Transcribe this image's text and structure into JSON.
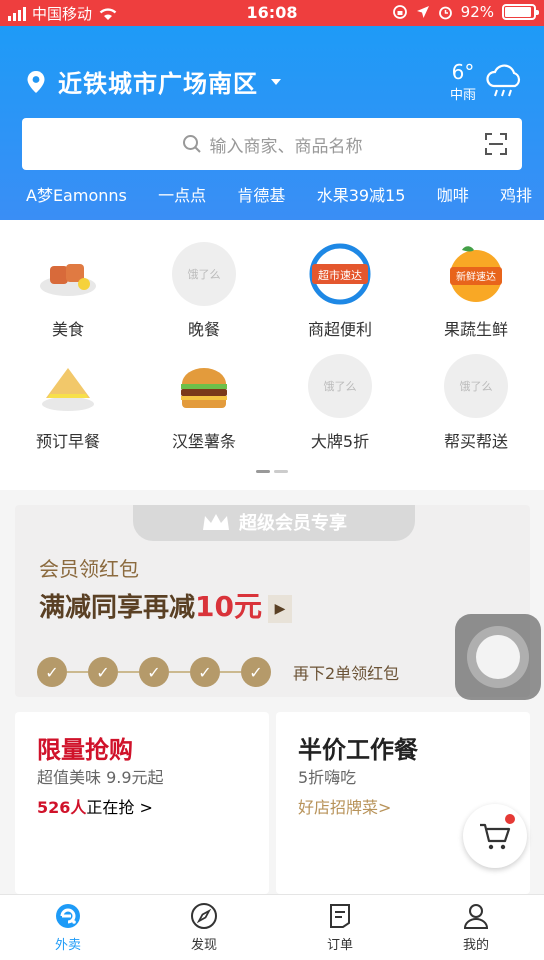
{
  "status": {
    "carrier": "中国移动",
    "time": "16:08",
    "battery": "92%",
    "battery_fraction": 0.92
  },
  "header": {
    "location": "近铁城市广场南区",
    "weather": {
      "temp": "6°",
      "desc": "中雨"
    },
    "search_placeholder": "输入商家、商品名称",
    "hot_keywords": [
      "A梦Eamonns",
      "一点点",
      "肯德基",
      "水果39减15",
      "咖啡",
      "鸡排"
    ]
  },
  "categories": [
    {
      "label": "美食",
      "icon": "grilled-food-icon"
    },
    {
      "label": "晚餐",
      "icon": "eleme-placeholder-icon",
      "ph": "饿了么"
    },
    {
      "label": "商超便利",
      "icon": "supermarket-badge-icon",
      "badge": "超市速达"
    },
    {
      "label": "果蔬生鲜",
      "icon": "orange-badge-icon",
      "badge": "新鲜速达"
    },
    {
      "label": "预订早餐",
      "icon": "sandwich-icon"
    },
    {
      "label": "汉堡薯条",
      "icon": "burger-icon"
    },
    {
      "label": "大牌5折",
      "icon": "eleme-placeholder-icon",
      "ph": "饿了么"
    },
    {
      "label": "帮买帮送",
      "icon": "eleme-placeholder-icon",
      "ph": "饿了么"
    }
  ],
  "member": {
    "tag": "超级会员专享",
    "line1": "会员领红包",
    "line2_prefix": "满减同享再减",
    "line2_amount": "10元",
    "progress_label": "再下2单领红包",
    "checks_done": 5
  },
  "promos": [
    {
      "title": "限量抢购",
      "subtitle": "超值美味 9.9元起",
      "link_num": "526人",
      "link_text": "正在抢 >",
      "title_color": "#d0122a"
    },
    {
      "title": "半价工作餐",
      "subtitle": "5折嗨吃",
      "link_text": "好店招牌菜>",
      "title_color": "#222222"
    }
  ],
  "tabs": [
    {
      "label": "外卖",
      "icon": "eleme-logo-icon",
      "active": true
    },
    {
      "label": "发现",
      "icon": "compass-icon",
      "active": false
    },
    {
      "label": "订单",
      "icon": "order-list-icon",
      "active": false
    },
    {
      "label": "我的",
      "icon": "user-icon",
      "active": false
    }
  ]
}
